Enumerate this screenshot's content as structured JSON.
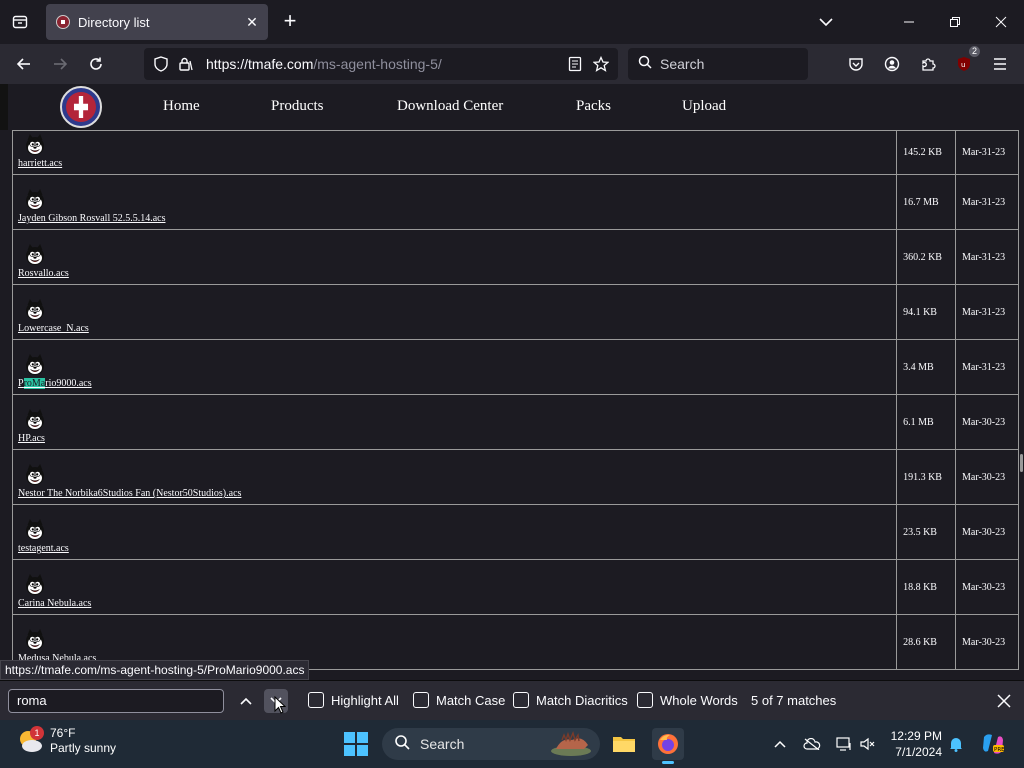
{
  "browser": {
    "tab": {
      "title": "Directory list"
    },
    "url": {
      "host": "https://tmafe.com",
      "path": "/ms-agent-hosting-5/"
    },
    "search_placeholder": "Search",
    "extension_badge": "2"
  },
  "site": {
    "nav": [
      "Home",
      "Products",
      "Download Center",
      "Packs",
      "Upload"
    ]
  },
  "files": [
    {
      "name": "harriett.acs",
      "size": "145.2 KB",
      "date": "Mar-31-23"
    },
    {
      "name": "Jayden Gibson Rosvall 52.5.5.14.acs",
      "size": "16.7 MB",
      "date": "Mar-31-23"
    },
    {
      "name": "Rosvallo.acs",
      "size": "360.2 KB",
      "date": "Mar-31-23"
    },
    {
      "name": "Lowercase_N.acs",
      "size": "94.1 KB",
      "date": "Mar-31-23"
    },
    {
      "name": "ProMario9000.acs",
      "name_pre": "P",
      "name_match": "roMa",
      "name_post": "rio9000.acs",
      "size": "3.4 MB",
      "date": "Mar-31-23"
    },
    {
      "name": "HP.acs",
      "size": "6.1 MB",
      "date": "Mar-30-23"
    },
    {
      "name": "Nestor The Norbika6Studios Fan (Nestor50Studios).acs",
      "size": "191.3 KB",
      "date": "Mar-30-23"
    },
    {
      "name": "testagent.acs",
      "size": "23.5 KB",
      "date": "Mar-30-23"
    },
    {
      "name": "Carina Nebula.acs",
      "size": "18.8 KB",
      "date": "Mar-30-23"
    },
    {
      "name": "Medusa Nebula.acs",
      "size": "28.6 KB",
      "date": "Mar-30-23"
    }
  ],
  "status_link": "https://tmafe.com/ms-agent-hosting-5/ProMario9000.acs",
  "findbar": {
    "query": "roma",
    "options": [
      "Highlight All",
      "Match Case",
      "Match Diacritics",
      "Whole Words"
    ],
    "matches": "5 of 7 matches"
  },
  "taskbar": {
    "weather_temp": "76°F",
    "weather_desc": "Partly sunny",
    "weather_badge": "1",
    "search_label": "Search",
    "time": "12:29 PM",
    "date": "7/1/2024"
  }
}
